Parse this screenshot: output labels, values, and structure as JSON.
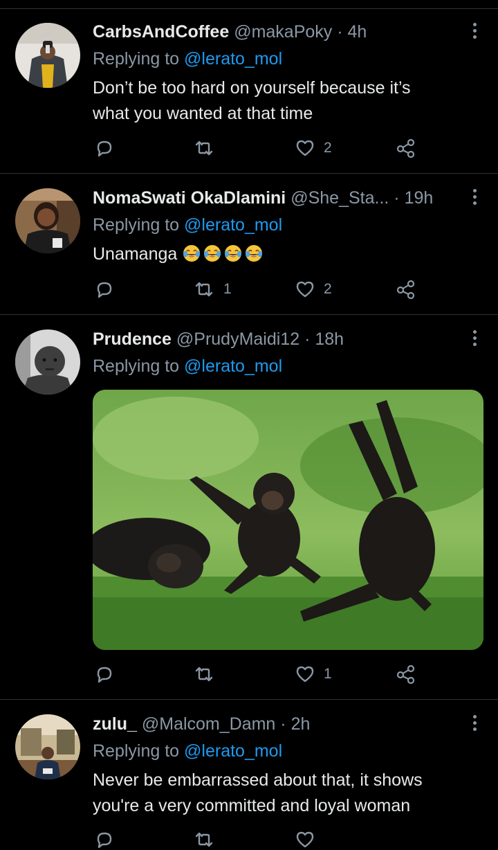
{
  "tweets": [
    {
      "name": "CarbsAndCoffee",
      "handle": "@makaPoky",
      "sep": "·",
      "time": "4h",
      "replying_prefix": "Replying to",
      "replying_to": "@lerato_mol",
      "text_lines": [
        "Don’t be too hard on yourself because it’s",
        "what you wanted at that time"
      ],
      "replies": "",
      "retweets": "",
      "likes": "2"
    },
    {
      "name": "NomaSwati OkaDlamini",
      "handle": "@She_Sta...",
      "sep": "·",
      "time": "19h",
      "replying_prefix": "Replying to",
      "replying_to": "@lerato_mol",
      "text": "Unamanga",
      "emoji_count": 4,
      "emoji_name": "face-with-tears-of-joy-icon",
      "replies": "",
      "retweets": "1",
      "likes": "2"
    },
    {
      "name": "Prudence",
      "handle": "@PrudyMaidi12",
      "sep": "·",
      "time": "18h",
      "replying_prefix": "Replying to",
      "replying_to": "@lerato_mol",
      "media": "photo of laughing chimpanzees",
      "replies": "",
      "retweets": "",
      "likes": "1"
    },
    {
      "name": "zulu_",
      "handle": "@Malcom_Damn",
      "sep": "·",
      "time": "2h",
      "replying_prefix": "Replying to",
      "replying_to": "@lerato_mol",
      "text_lines": [
        "Never be embarrassed about that, it shows",
        "you're a very committed and loyal woman"
      ]
    }
  ],
  "icons": {
    "reply": "reply-icon",
    "retweet": "retweet-icon",
    "like": "heart-icon",
    "share": "share-icon",
    "more": "more-icon"
  },
  "colors": {
    "background": "#000000",
    "text": "#e7e9ea",
    "secondary": "#8b98a5",
    "link": "#1d9bf0",
    "divider": "#2f3336"
  }
}
